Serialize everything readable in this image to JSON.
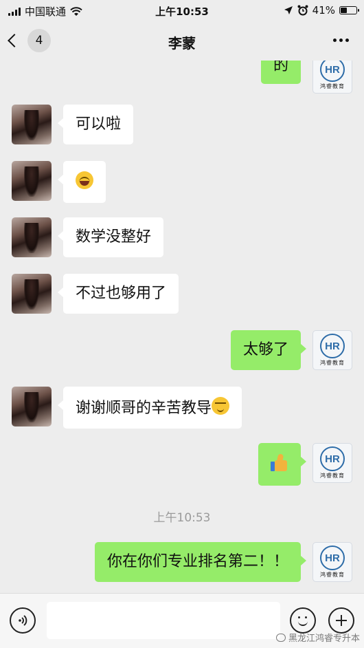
{
  "status_bar": {
    "carrier": "中国联通",
    "time": "上午10:53",
    "battery": "41%",
    "battery_level": 0.41
  },
  "nav": {
    "unread_count": "4",
    "title": "李蒙"
  },
  "chat": {
    "partial_top": {
      "side": "right",
      "text": "的"
    },
    "messages": [
      {
        "side": "left",
        "text": "可以啦"
      },
      {
        "side": "left",
        "text": "",
        "emoji": "laughing-tears"
      },
      {
        "side": "left",
        "text": "数学没整好"
      },
      {
        "side": "left",
        "text": "不过也够用了"
      },
      {
        "side": "right",
        "text": "太够了"
      },
      {
        "side": "left",
        "text": "谢谢顺哥的辛苦教导",
        "emoji": "smug-face"
      },
      {
        "side": "right",
        "text": "",
        "emoji": "thumbs-up"
      },
      {
        "side": "right",
        "text": "你在你们专业排名第二！！"
      }
    ],
    "timestamp": "上午10:53"
  },
  "avatar_right": {
    "logo_letters": "HR",
    "logo_text": "鸿睿教育"
  },
  "input": {
    "placeholder": ""
  },
  "watermark": "黑龙江鸿睿专升本"
}
